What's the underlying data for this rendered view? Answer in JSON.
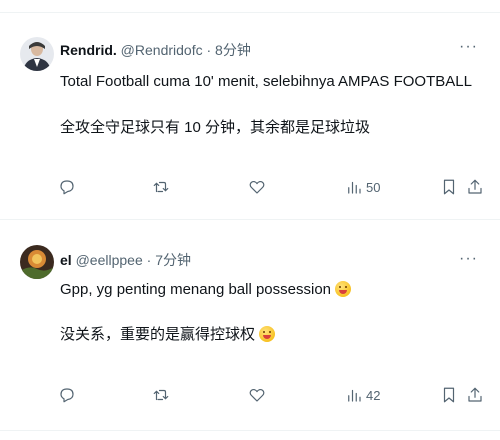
{
  "tweets": [
    {
      "name": "Rendrid.",
      "handle": "@Rendridofc",
      "separator": "·",
      "time": "8分钟",
      "lines": [
        "Total Football cuma 10' menit, selebihnya AMPAS FOOTBALL",
        "全攻全守足球只有 10 分钟，其余都是足球垃圾"
      ],
      "views": "50",
      "more": "···"
    },
    {
      "name": "el",
      "handle": "@eellppee",
      "separator": "·",
      "time": "7分钟",
      "lines": [
        "Gpp, yg penting menang ball possession",
        "没关系，重要的是赢得控球权"
      ],
      "views": "42",
      "more": "···"
    }
  ],
  "icons": [
    "reply-icon",
    "retweet-icon",
    "like-icon",
    "views-icon",
    "bookmark-icon",
    "share-icon",
    "more-icon",
    "smiling-emoji-icon"
  ],
  "colors": {
    "text": "#0f1419",
    "secondary": "#536471",
    "divider": "#eff3f4"
  }
}
